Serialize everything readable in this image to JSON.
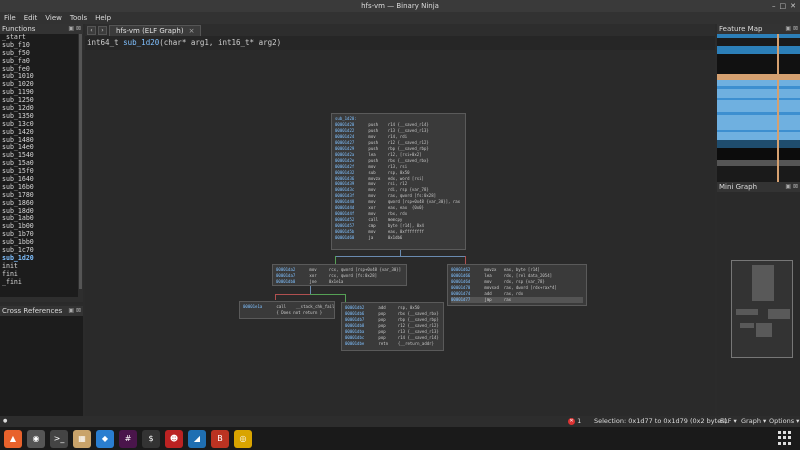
{
  "window": {
    "title": "hfs-vm — Binary Ninja",
    "controls": [
      "–",
      "□",
      "✕"
    ]
  },
  "menu": [
    "File",
    "Edit",
    "View",
    "Tools",
    "Help"
  ],
  "functions_panel": {
    "title": "Functions",
    "items": [
      "_start",
      "sub_f10",
      "sub_f50",
      "sub_fa0",
      "sub_fe0",
      "sub_1010",
      "sub_1020",
      "sub_1190",
      "sub_1250",
      "sub_12d0",
      "sub_1350",
      "sub_13c0",
      "sub_1420",
      "sub_1480",
      "sub_14e0",
      "sub_1540",
      "sub_15a0",
      "sub_15f0",
      "sub_1640",
      "sub_16b0",
      "sub_1780",
      "sub_1860",
      "sub_18d0",
      "sub_1ab0",
      "sub_1b00",
      "sub_1b70",
      "sub_1bb0",
      "sub_1c70",
      "sub_1d20",
      "init",
      "fini",
      "_fini"
    ],
    "active": "sub_1d20"
  },
  "xrefs_panel": {
    "title": "Cross References"
  },
  "panel_buttons": "▣ ⊠",
  "tab": {
    "label": "hfs-vm (ELF Graph)",
    "close": "×"
  },
  "nav": {
    "back": "‹",
    "forward": "›"
  },
  "signature": {
    "ret_type": "int64_t",
    "name": "sub_1d20",
    "params": "(char* arg1, int16_t* arg2)"
  },
  "graph": {
    "blocks": [
      {
        "id": "entry",
        "header": "sub_1d20:",
        "rows": [
          [
            "00001d20",
            "push",
            "r14 {__saved_r14}"
          ],
          [
            "00001d22",
            "push",
            "r13 {__saved_r13}"
          ],
          [
            "00001d24",
            "mov",
            "r14, rdi"
          ],
          [
            "00001d27",
            "push",
            "r12 {__saved_r12}"
          ],
          [
            "00001d29",
            "push",
            "rbp {__saved_rbp}"
          ],
          [
            "00001d2a",
            "lea",
            "r12, [rsi+0x2]"
          ],
          [
            "00001d2e",
            "push",
            "rbx {__saved_rbx}"
          ],
          [
            "00001d2f",
            "mov",
            "r13, rsi"
          ],
          [
            "00001d32",
            "sub",
            "rsp, 0x50"
          ],
          [
            "00001d36",
            "movzx",
            "edx, word [rsi]"
          ],
          [
            "00001d39",
            "mov",
            "rsi, r12"
          ],
          [
            "00001d3c",
            "mov",
            "rdi, rsp {var_78}"
          ],
          [
            "00001d3f",
            "mov",
            "rax, qword [fs:0x28]"
          ],
          [
            "00001d48",
            "mov",
            "qword [rsp+0x48 {var_30}], rax"
          ],
          [
            "00001d4d",
            "xor",
            "eax, eax  {0x0}"
          ],
          [
            "00001d4f",
            "mov",
            "rbx, rdx"
          ],
          [
            "00001d52",
            "call",
            "memcpy"
          ],
          [
            "00001d57",
            "cmp",
            "byte [r14], 0x4"
          ],
          [
            "00001d5b",
            "mov",
            "eax, 0xffffffff"
          ],
          [
            "00001d60",
            "ja",
            "0x1db6"
          ]
        ]
      },
      {
        "id": "check",
        "rows": [
          [
            "00001da2",
            "mov",
            "rcx, qword [rsp+0x48 {var_30}]"
          ],
          [
            "00001da7",
            "xor",
            "rcx, qword [fs:0x28]"
          ],
          [
            "00001db0",
            "jne",
            "0x1e1a"
          ]
        ]
      },
      {
        "id": "switch",
        "rows": [
          [
            "00001d62",
            "movzx",
            "eax, byte [r14]"
          ],
          [
            "00001d66",
            "lea",
            "rdx, [rel data_2054]"
          ],
          [
            "00001d6d",
            "mov",
            "rdx, rsp {var_78}"
          ],
          [
            "00001d70",
            "movsxd",
            "rax, dword [rdx+rax*4]"
          ],
          [
            "00001d74",
            "add",
            "rax, rdx"
          ],
          [
            "00001d77",
            "jmp",
            "rax"
          ]
        ],
        "selected_row": 5
      },
      {
        "id": "fail",
        "rows": [
          [
            "00001e1a",
            "call",
            "__stack_chk_fail"
          ],
          [
            "",
            "{ Does not return }",
            ""
          ]
        ]
      },
      {
        "id": "ret",
        "rows": [
          [
            "00001db2",
            "add",
            "rsp, 0x50"
          ],
          [
            "00001db6",
            "pop",
            "rbx {__saved_rbx}"
          ],
          [
            "00001db7",
            "pop",
            "rbp {__saved_rbp}"
          ],
          [
            "00001db8",
            "pop",
            "r12 {__saved_r12}"
          ],
          [
            "00001dba",
            "pop",
            "r13 {__saved_r13}"
          ],
          [
            "00001dbc",
            "pop",
            "r14 {__saved_r14}"
          ],
          [
            "00001dbe",
            "retn",
            "{__return_addr}"
          ]
        ]
      }
    ]
  },
  "feature_map": {
    "title": "Feature Map"
  },
  "mini_graph": {
    "title": "Mini Graph"
  },
  "status": {
    "left_indicator": "●",
    "errors": "1",
    "selection": "Selection: 0x1d77 to 0x1d79 (0x2 bytes)",
    "view_type": "ELF ▾",
    "view_mode": "Graph ▾",
    "options": "Options ▾"
  },
  "taskbar": [
    {
      "name": "app-launcher",
      "glyph": "▲",
      "color": "#e8622c"
    },
    {
      "name": "camera",
      "glyph": "◉",
      "color": "#555"
    },
    {
      "name": "terminal-dark",
      "glyph": ">_",
      "color": "#444"
    },
    {
      "name": "calendar",
      "glyph": "▦",
      "color": "#c9a36a"
    },
    {
      "name": "docker",
      "glyph": "◆",
      "color": "#2a7ed0"
    },
    {
      "name": "slack",
      "glyph": "#",
      "color": "#4a154b"
    },
    {
      "name": "terminal",
      "glyph": "$",
      "color": "#333"
    },
    {
      "name": "ghidra",
      "glyph": "☻",
      "color": "#b22"
    },
    {
      "name": "vscode",
      "glyph": "◢",
      "color": "#1f6fb2"
    },
    {
      "name": "binja",
      "glyph": "B",
      "color": "#b32"
    },
    {
      "name": "chrome",
      "glyph": "◎",
      "color": "#d9a400"
    }
  ]
}
